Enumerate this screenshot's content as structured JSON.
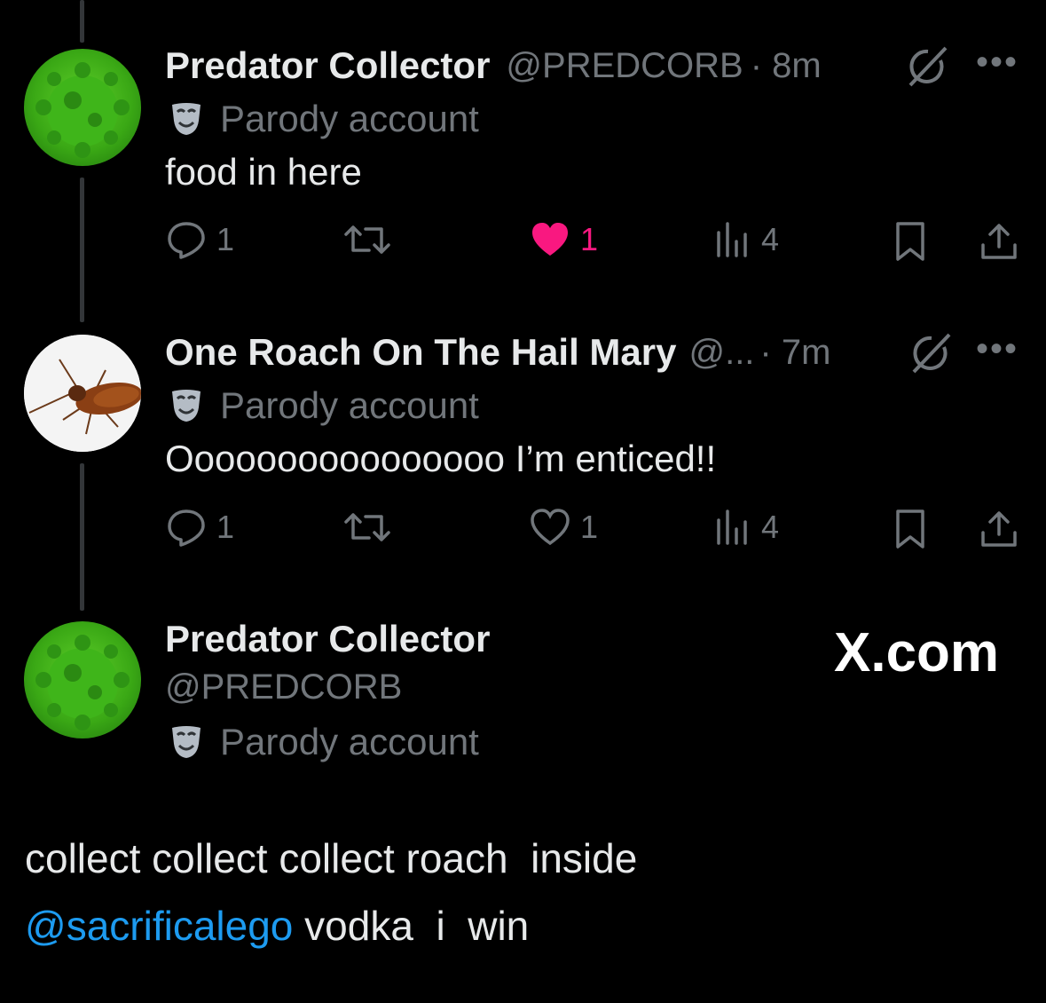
{
  "tweets": [
    {
      "name": "Predator Collector",
      "handle": "@PREDCORB",
      "time": "· 8m",
      "badge": "Parody account",
      "text": "food in here",
      "replies": "1",
      "likes": "1",
      "liked": true,
      "views": "4"
    },
    {
      "name": "One Roach On The Hail Mary",
      "handle": "@...",
      "time": "· 7m",
      "badge": "Parody account",
      "text": "Oooooooooooooooo I’m enticed!!",
      "replies": "1",
      "likes": "1",
      "liked": false,
      "views": "4"
    }
  ],
  "focused": {
    "name": "Predator Collector",
    "handle": "@PREDCORB",
    "badge": "Parody account",
    "line1": "collect collect collect roach  inside",
    "mention": "@sacrificalego",
    "line2_rest": " vodka  i  win"
  },
  "watermark": "X.com",
  "icons": {
    "more": "more-icon",
    "grok": "grok-icon",
    "reply": "reply-icon",
    "retweet": "retweet-icon",
    "like": "heart-icon",
    "views": "views-icon",
    "bookmark": "bookmark-icon",
    "share": "share-icon",
    "parody": "parody-mask-icon"
  },
  "colors": {
    "background": "#000000",
    "text": "#e7e9ea",
    "muted": "#71767b",
    "like": "#f91880",
    "mention": "#1d9bf0"
  }
}
